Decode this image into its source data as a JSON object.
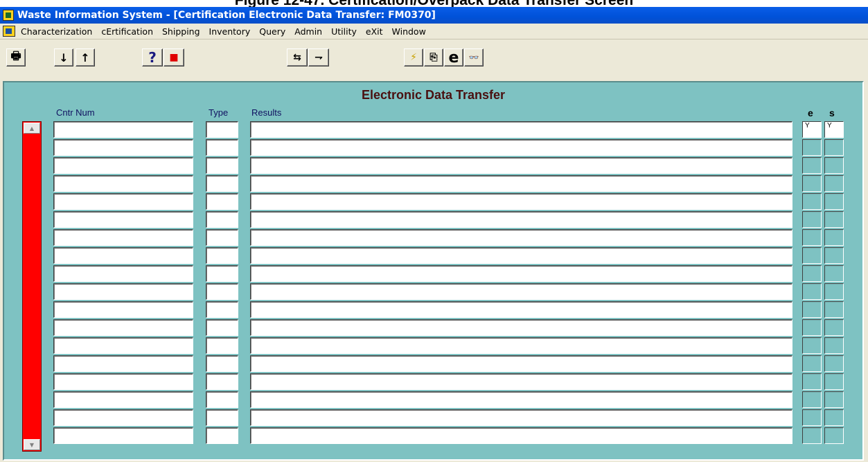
{
  "document_caption": "Figure 12-47. Certification/Overpack Data Transfer Screen",
  "window": {
    "title": "Waste Information System - [Certification Electronic Data Transfer: FM0370]"
  },
  "menu": {
    "items": [
      "Characterization",
      "cErtification",
      "Shipping",
      "Inventory",
      "Query",
      "Admin",
      "Utility",
      "eXit",
      "Window"
    ]
  },
  "toolbar": {
    "print": "🖶",
    "next_record": "↓",
    "prev_record": "↑",
    "help": "?",
    "exit": "■",
    "tool_a": "⇆",
    "tool_b": "⇁",
    "execute": "⚡",
    "copy": "⎘",
    "e_button": "e",
    "view": "👓"
  },
  "form": {
    "title": "Electronic Data Transfer",
    "headers": {
      "cntr_num": "Cntr Num",
      "type": "Type",
      "results": "Results",
      "e": "e",
      "s": "s"
    },
    "scroll_up": "▲",
    "scroll_down": "▼",
    "rows": [
      {
        "cntr_num": "",
        "type": "",
        "results": "",
        "e": "Y",
        "s": "Y"
      },
      {
        "cntr_num": "",
        "type": "",
        "results": "",
        "e": "",
        "s": ""
      },
      {
        "cntr_num": "",
        "type": "",
        "results": "",
        "e": "",
        "s": ""
      },
      {
        "cntr_num": "",
        "type": "",
        "results": "",
        "e": "",
        "s": ""
      },
      {
        "cntr_num": "",
        "type": "",
        "results": "",
        "e": "",
        "s": ""
      },
      {
        "cntr_num": "",
        "type": "",
        "results": "",
        "e": "",
        "s": ""
      },
      {
        "cntr_num": "",
        "type": "",
        "results": "",
        "e": "",
        "s": ""
      },
      {
        "cntr_num": "",
        "type": "",
        "results": "",
        "e": "",
        "s": ""
      },
      {
        "cntr_num": "",
        "type": "",
        "results": "",
        "e": "",
        "s": ""
      },
      {
        "cntr_num": "",
        "type": "",
        "results": "",
        "e": "",
        "s": ""
      },
      {
        "cntr_num": "",
        "type": "",
        "results": "",
        "e": "",
        "s": ""
      },
      {
        "cntr_num": "",
        "type": "",
        "results": "",
        "e": "",
        "s": ""
      },
      {
        "cntr_num": "",
        "type": "",
        "results": "",
        "e": "",
        "s": ""
      },
      {
        "cntr_num": "",
        "type": "",
        "results": "",
        "e": "",
        "s": ""
      },
      {
        "cntr_num": "",
        "type": "",
        "results": "",
        "e": "",
        "s": ""
      },
      {
        "cntr_num": "",
        "type": "",
        "results": "",
        "e": "",
        "s": ""
      },
      {
        "cntr_num": "",
        "type": "",
        "results": "",
        "e": "",
        "s": ""
      },
      {
        "cntr_num": "",
        "type": "",
        "results": "",
        "e": "",
        "s": ""
      }
    ]
  },
  "colors": {
    "title_bar": "#0051d8",
    "form_bg": "#7ec2c2",
    "scrollbar": "#ff0000",
    "form_title": "#4a1010"
  }
}
